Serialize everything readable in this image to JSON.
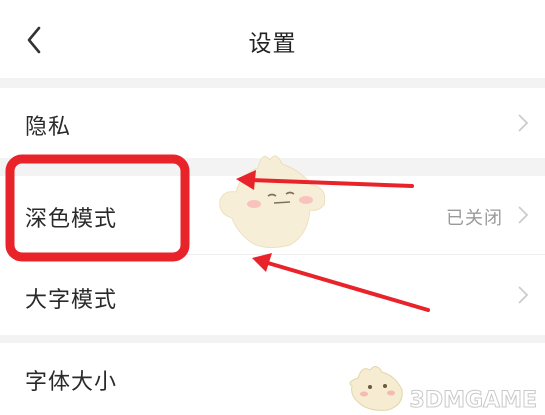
{
  "header": {
    "title": "设置",
    "back_icon": "chevron-left-icon"
  },
  "settings": [
    {
      "label": "隐私",
      "value": ""
    },
    {
      "label": "深色模式",
      "value": "已关闭"
    },
    {
      "label": "大字模式",
      "value": ""
    },
    {
      "label": "字体大小",
      "value": ""
    }
  ],
  "watermark": {
    "text": "3DMGAME"
  },
  "colors": {
    "highlight": "#e8232a",
    "section_gap": "#f3f3f3",
    "chevron": "#cccccc",
    "mascot": "#f6ecd2"
  }
}
